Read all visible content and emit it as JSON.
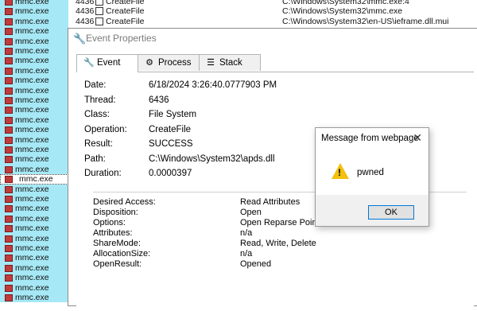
{
  "background": {
    "rows": [
      {
        "proc": "mmc.exe",
        "pid": "4436",
        "op": "CreateFile",
        "path": "C:\\Windows\\System32\\mmc.exe:4"
      },
      {
        "proc": "mmc.exe",
        "pid": "4436",
        "op": "CreateFile",
        "path": "C:\\Windows\\System32\\mmc.exe"
      },
      {
        "proc": "mmc.exe",
        "pid": "4436",
        "op": "CreateFile",
        "path": "C:\\Windows\\System32\\en-US\\ieframe.dll.mui"
      },
      {
        "proc": "mmc.exe",
        "pid": "",
        "op": "",
        "path": ""
      },
      {
        "proc": "mmc.exe",
        "pid": "",
        "op": "",
        "path": ""
      },
      {
        "proc": "mmc.exe",
        "pid": "",
        "op": "",
        "path": ""
      },
      {
        "proc": "mmc.exe",
        "pid": "",
        "op": "",
        "path": ""
      },
      {
        "proc": "mmc.exe",
        "pid": "",
        "op": "",
        "path": ""
      },
      {
        "proc": "mmc.exe",
        "pid": "",
        "op": "",
        "path": ""
      },
      {
        "proc": "mmc.exe",
        "pid": "",
        "op": "",
        "path": ""
      },
      {
        "proc": "mmc.exe",
        "pid": "",
        "op": "",
        "path": ""
      },
      {
        "proc": "mmc.exe",
        "pid": "",
        "op": "",
        "path": ""
      },
      {
        "proc": "mmc.exe",
        "pid": "",
        "op": "",
        "path": ""
      },
      {
        "proc": "mmc.exe",
        "pid": "",
        "op": "",
        "path": ""
      },
      {
        "proc": "mmc.exe",
        "pid": "",
        "op": "",
        "path": ""
      },
      {
        "proc": "mmc.exe",
        "pid": "",
        "op": "",
        "path": ""
      },
      {
        "proc": "mmc.exe",
        "pid": "",
        "op": "",
        "path": ""
      },
      {
        "proc": "mmc.exe",
        "pid": "",
        "op": "",
        "path": ""
      },
      {
        "proc": "mmc.exe",
        "pid": "",
        "op": "",
        "path": "",
        "selected": true
      },
      {
        "proc": "mmc.exe",
        "pid": "",
        "op": "",
        "path": ""
      },
      {
        "proc": "mmc.exe",
        "pid": "",
        "op": "",
        "path": ""
      },
      {
        "proc": "mmc.exe",
        "pid": "",
        "op": "",
        "path": ""
      },
      {
        "proc": "mmc.exe",
        "pid": "",
        "op": "",
        "path": ""
      },
      {
        "proc": "mmc.exe",
        "pid": "",
        "op": "",
        "path": ""
      },
      {
        "proc": "mmc.exe",
        "pid": "",
        "op": "",
        "path": ""
      },
      {
        "proc": "mmc.exe",
        "pid": "",
        "op": "",
        "path": ""
      },
      {
        "proc": "mmc.exe",
        "pid": "",
        "op": "",
        "path": ""
      },
      {
        "proc": "mmc.exe",
        "pid": "",
        "op": "",
        "path": ""
      },
      {
        "proc": "mmc.exe",
        "pid": "",
        "op": "",
        "path": ""
      },
      {
        "proc": "mmc.exe",
        "pid": "",
        "op": "",
        "path": ""
      },
      {
        "proc": "mmc.exe",
        "pid": "",
        "op": "",
        "path": ""
      }
    ]
  },
  "event_window": {
    "title": "Event Properties",
    "icon": "wrench-icon",
    "tabs": [
      {
        "label": "Event",
        "icon": "wrench-icon"
      },
      {
        "label": "Process",
        "icon": "gear-icon"
      },
      {
        "label": "Stack",
        "icon": "stack-icon"
      }
    ],
    "fields": [
      {
        "key": "Date:",
        "value": "6/18/2024 3:26:40.0777903 PM"
      },
      {
        "key": "Thread:",
        "value": "6436"
      },
      {
        "key": "Class:",
        "value": "File System"
      },
      {
        "key": "Operation:",
        "value": "CreateFile"
      },
      {
        "key": "Result:",
        "value": "SUCCESS"
      },
      {
        "key": "Path:",
        "value": "C:\\Windows\\System32\\apds.dll"
      },
      {
        "key": "Duration:",
        "value": "0.0000397"
      }
    ],
    "details": [
      {
        "key": "Desired Access:",
        "value": "Read Attributes"
      },
      {
        "key": "Disposition:",
        "value": "Open"
      },
      {
        "key": "Options:",
        "value": "Open Reparse Point"
      },
      {
        "key": "Attributes:",
        "value": "n/a"
      },
      {
        "key": "ShareMode:",
        "value": "Read, Write, Delete"
      },
      {
        "key": "AllocationSize:",
        "value": "n/a"
      },
      {
        "key": "OpenResult:",
        "value": "Opened"
      }
    ]
  },
  "dialog": {
    "title": "Message from webpage",
    "message": "pwned",
    "ok_label": "OK",
    "close_glyph": "✕",
    "icon": "warning-icon"
  },
  "colors": {
    "process_column_bg": "#a6e8f5",
    "warning": "#f2c10f",
    "focus_border": "#0078d7"
  }
}
